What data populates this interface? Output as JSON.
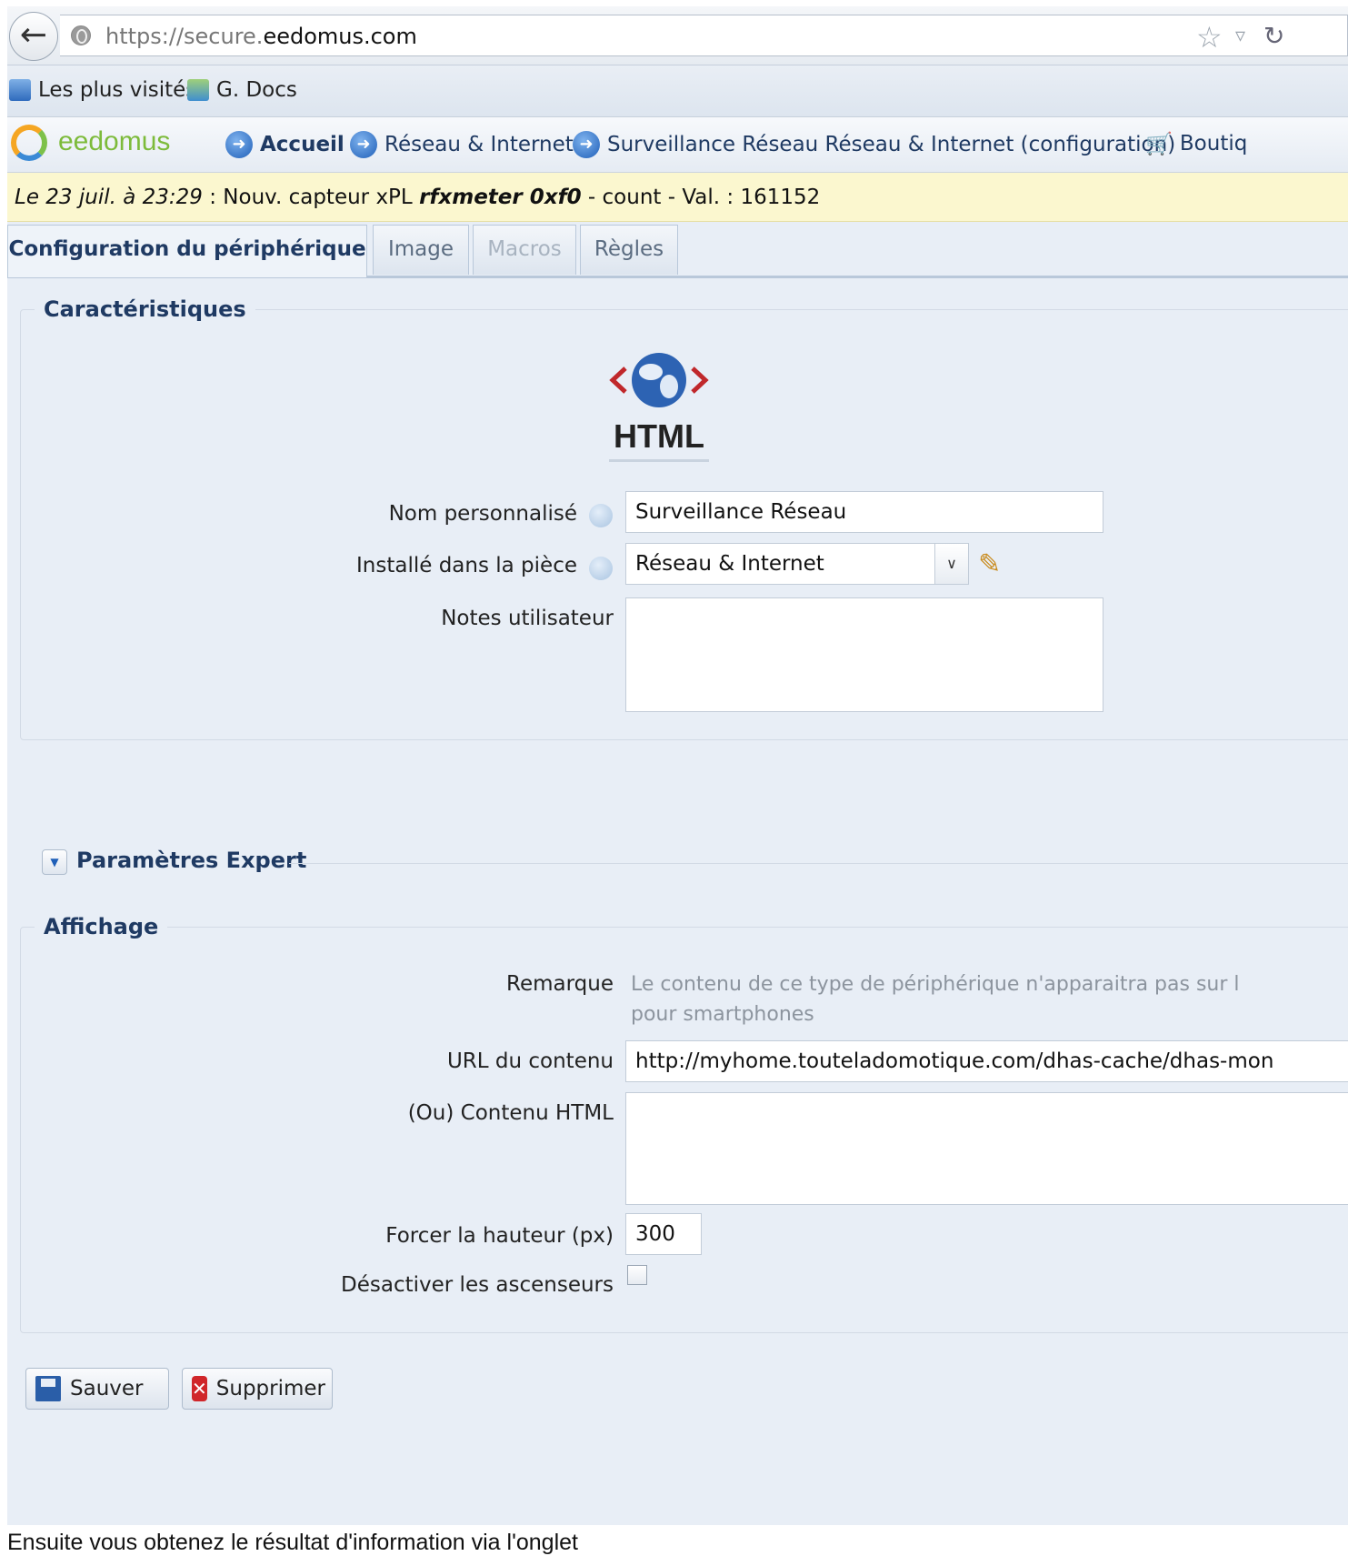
{
  "browser": {
    "url_prefix": "https://secure.",
    "url_domain": "eedomus.com",
    "bookmarks": [
      "Les plus visités",
      "G. Docs"
    ]
  },
  "app": {
    "logo": "eedomus",
    "nav": [
      "Accueil",
      "Réseau & Internet",
      "Surveillance Réseau Réseau & Internet (configuration)",
      "Boutiq"
    ]
  },
  "notification": {
    "date": "Le 23 juil. à 23:29",
    "prefix": " : Nouv. capteur xPL ",
    "device": "rfxmeter 0xf0",
    "suffix": " - count - Val. : 161152"
  },
  "tabs": [
    {
      "label": "Configuration du périphérique",
      "state": "active"
    },
    {
      "label": "Image",
      "state": "normal"
    },
    {
      "label": "Macros",
      "state": "disabled"
    },
    {
      "label": "Règles",
      "state": "normal"
    }
  ],
  "characteristics": {
    "legend": "Caractéristiques",
    "type_logo": "HTML",
    "name_label": "Nom personnalisé",
    "name_value": "Surveillance Réseau",
    "room_label": "Installé dans la pièce",
    "room_value": "Réseau & Internet",
    "notes_label": "Notes utilisateur",
    "notes_value": ""
  },
  "expert": {
    "label": "Paramètres Expert"
  },
  "display": {
    "legend": "Affichage",
    "remark_label": "Remarque",
    "remark_line1": "Le contenu de ce type de périphérique n'apparaitra pas sur l",
    "remark_line2": "pour smartphones",
    "url_label": "URL du contenu",
    "url_value": "http://myhome.touteladomotique.com/dhas-cache/dhas-mon",
    "html_label": "(Ou) Contenu HTML",
    "html_value": "",
    "height_label": "Forcer la hauteur (px)",
    "height_value": "300",
    "scroll_label": "Désactiver les ascenseurs",
    "scroll_checked": false
  },
  "buttons": {
    "save": "Sauver",
    "delete": "Supprimer"
  },
  "footer_text": "Ensuite vous obtenez le résultat d'information via l'onglet"
}
